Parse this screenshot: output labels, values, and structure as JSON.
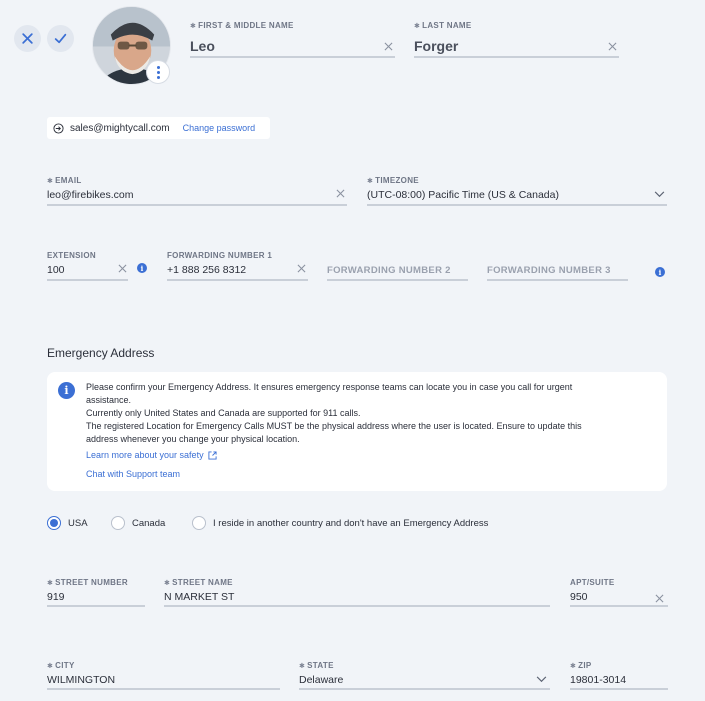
{
  "profile": {
    "first_label": "FIRST & MIDDLE NAME",
    "first_value": "Leo",
    "last_label": "LAST NAME",
    "last_value": "Forger"
  },
  "account": {
    "email": "sales@mightycall.com",
    "change_password": "Change password"
  },
  "contact": {
    "email_label": "EMAIL",
    "email_value": "leo@firebikes.com",
    "timezone_label": "TIMEZONE",
    "timezone_value": "(UTC-08:00) Pacific Time (US & Canada)"
  },
  "phones": {
    "extension_label": "EXTENSION",
    "extension_value": "100",
    "fwd1_label": "FORWARDING NUMBER 1",
    "fwd1_value": "+1 888 256 8312",
    "fwd2_placeholder": "FORWARDING NUMBER 2",
    "fwd3_placeholder": "FORWARDING NUMBER 3"
  },
  "emergency": {
    "title": "Emergency Address",
    "line1": "Please confirm your Emergency Address. It ensures emergency response teams can locate you in case you call for urgent",
    "line2": "assistance.",
    "line3": "Currently only United States and Canada are supported for 911 calls.",
    "line4": "The registered Location for Emergency Calls MUST be the physical address where the user is located. Ensure to update this",
    "line5": "address whenever you change your physical location.",
    "learn_more": "Learn more about your safety",
    "chat_support": "Chat with Support team",
    "radio_usa": "USA",
    "radio_canada": "Canada",
    "radio_other": "I reside in another country and don't have an Emergency Address",
    "selected": "USA"
  },
  "address": {
    "street_number_label": "STREET NUMBER",
    "street_number_value": "919",
    "street_name_label": "STREET NAME",
    "street_name_value": "N MARKET ST",
    "apt_label": "APT/SUITE",
    "apt_value": "950",
    "city_label": "CITY",
    "city_value": "WILMINGTON",
    "state_label": "STATE",
    "state_value": "Delaware",
    "zip_label": "ZIP",
    "zip_value": "19801-3014"
  },
  "colors": {
    "accent": "#3b6fd4",
    "background": "#f1f4f8",
    "card": "#ffffff"
  },
  "icons": [
    "close-icon",
    "check-icon",
    "more-vertical-icon",
    "sign-in-icon",
    "info-icon",
    "external-link-icon",
    "chevron-down-icon",
    "clear-icon"
  ]
}
